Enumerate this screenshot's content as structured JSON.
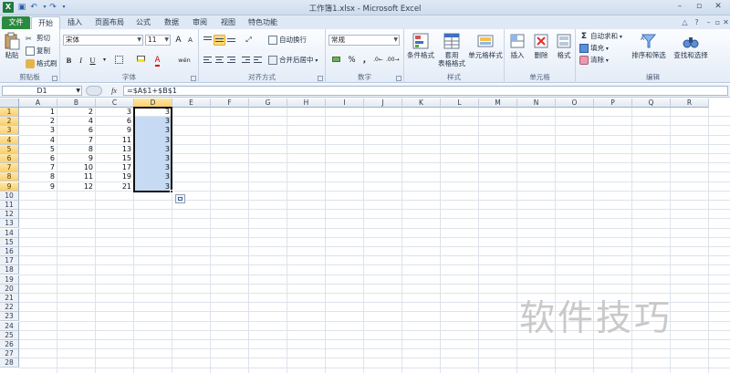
{
  "title_bar": {
    "window_title": "工作簿1.xlsx - Microsoft Excel",
    "app_icon_label": "X"
  },
  "tabs": [
    {
      "label": "文件"
    },
    {
      "label": "开始"
    },
    {
      "label": "插入"
    },
    {
      "label": "页面布局"
    },
    {
      "label": "公式"
    },
    {
      "label": "数据"
    },
    {
      "label": "审阅"
    },
    {
      "label": "视图"
    },
    {
      "label": "特色功能"
    }
  ],
  "ribbon": {
    "clipboard": {
      "paste": "粘贴",
      "cut": "剪切",
      "copy": "复制",
      "format_painter": "格式刷",
      "group_label": "剪贴板"
    },
    "font": {
      "font_name": "宋体",
      "font_size": "11",
      "bold": "B",
      "italic": "I",
      "underline": "U",
      "grow": "A",
      "shrink": "A",
      "font_color": "A",
      "wen": "wén",
      "group_label": "字体"
    },
    "alignment": {
      "wrap_text": "自动换行",
      "merge_center": "合并后居中",
      "group_label": "对齐方式"
    },
    "number": {
      "format": "常规",
      "percent": "%",
      "comma": ",",
      "group_label": "数字"
    },
    "styles": {
      "conditional": "条件格式",
      "table_top": "套用",
      "table_bottom": "表格格式",
      "cell_styles": "单元格样式",
      "group_label": "样式"
    },
    "cells": {
      "insert": "插入",
      "delete": "删除",
      "format": "格式",
      "group_label": "单元格"
    },
    "editing": {
      "autosum": "自动求和",
      "fill": "填充",
      "clear": "清除",
      "sort_filter": "排序和筛选",
      "find_select": "查找和选择",
      "group_label": "编辑"
    }
  },
  "formula_bar": {
    "name_box": "D1",
    "fx_label": "fx",
    "formula": "=$A$1+$B$1"
  },
  "sheet": {
    "columns": [
      "A",
      "B",
      "C",
      "D",
      "E",
      "F",
      "G",
      "H",
      "I",
      "J",
      "K",
      "L",
      "M",
      "N",
      "O",
      "P",
      "Q",
      "R"
    ],
    "rows": [
      "1",
      "2",
      "3",
      "4",
      "5",
      "6",
      "7",
      "8",
      "9",
      "10",
      "11",
      "12",
      "13",
      "14",
      "15",
      "16",
      "17",
      "18",
      "19",
      "20",
      "21",
      "22",
      "23",
      "24",
      "25",
      "26",
      "27",
      "28"
    ],
    "data": {
      "A": [
        "1",
        "2",
        "3",
        "4",
        "5",
        "6",
        "7",
        "8",
        "9"
      ],
      "B": [
        "2",
        "4",
        "6",
        "7",
        "8",
        "9",
        "10",
        "11",
        "12"
      ],
      "C": [
        "3",
        "6",
        "9",
        "11",
        "13",
        "15",
        "17",
        "19",
        "21"
      ],
      "D": [
        "3",
        "3",
        "3",
        "3",
        "3",
        "3",
        "3",
        "3",
        "3"
      ]
    },
    "selected_column": "D",
    "selected_rows": 9
  },
  "watermark": "软件技巧",
  "colors": {
    "accent": "#2a8a3f",
    "selection": "#c6dbf3",
    "header_highlight": "#f9cf6f"
  }
}
